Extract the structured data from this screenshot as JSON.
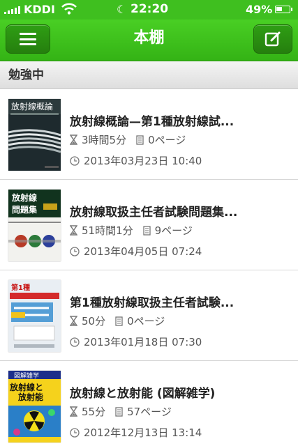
{
  "status_bar": {
    "carrier": "KDDI",
    "time": "22:20",
    "battery_percent": "49%",
    "battery_level": 0.49
  },
  "nav": {
    "title": "本棚",
    "left_icon": "menu-icon",
    "right_icon": "compose-icon"
  },
  "section": {
    "title": "勉強中"
  },
  "books": [
    {
      "title": "放射線概論—第1種放射線試...",
      "duration": "3時間5分",
      "pages": "0ページ",
      "date": "2013年03月23日 10:40"
    },
    {
      "title": "放射線取扱主任者試験問題集...",
      "duration": "51時間1分",
      "pages": "9ページ",
      "date": "2013年04月05日 07:24"
    },
    {
      "title": "第1種放射線取扱主任者試験...",
      "duration": "50分",
      "pages": "0ページ",
      "date": "2013年01月18日 07:30"
    },
    {
      "title": "放射線と放射能 (図解雑学)",
      "duration": "55分",
      "pages": "57ページ",
      "date": "2012年12月13日 13:14"
    }
  ],
  "colors": {
    "accent": "#3fbf1f",
    "nav_button": "#2f9e14"
  }
}
